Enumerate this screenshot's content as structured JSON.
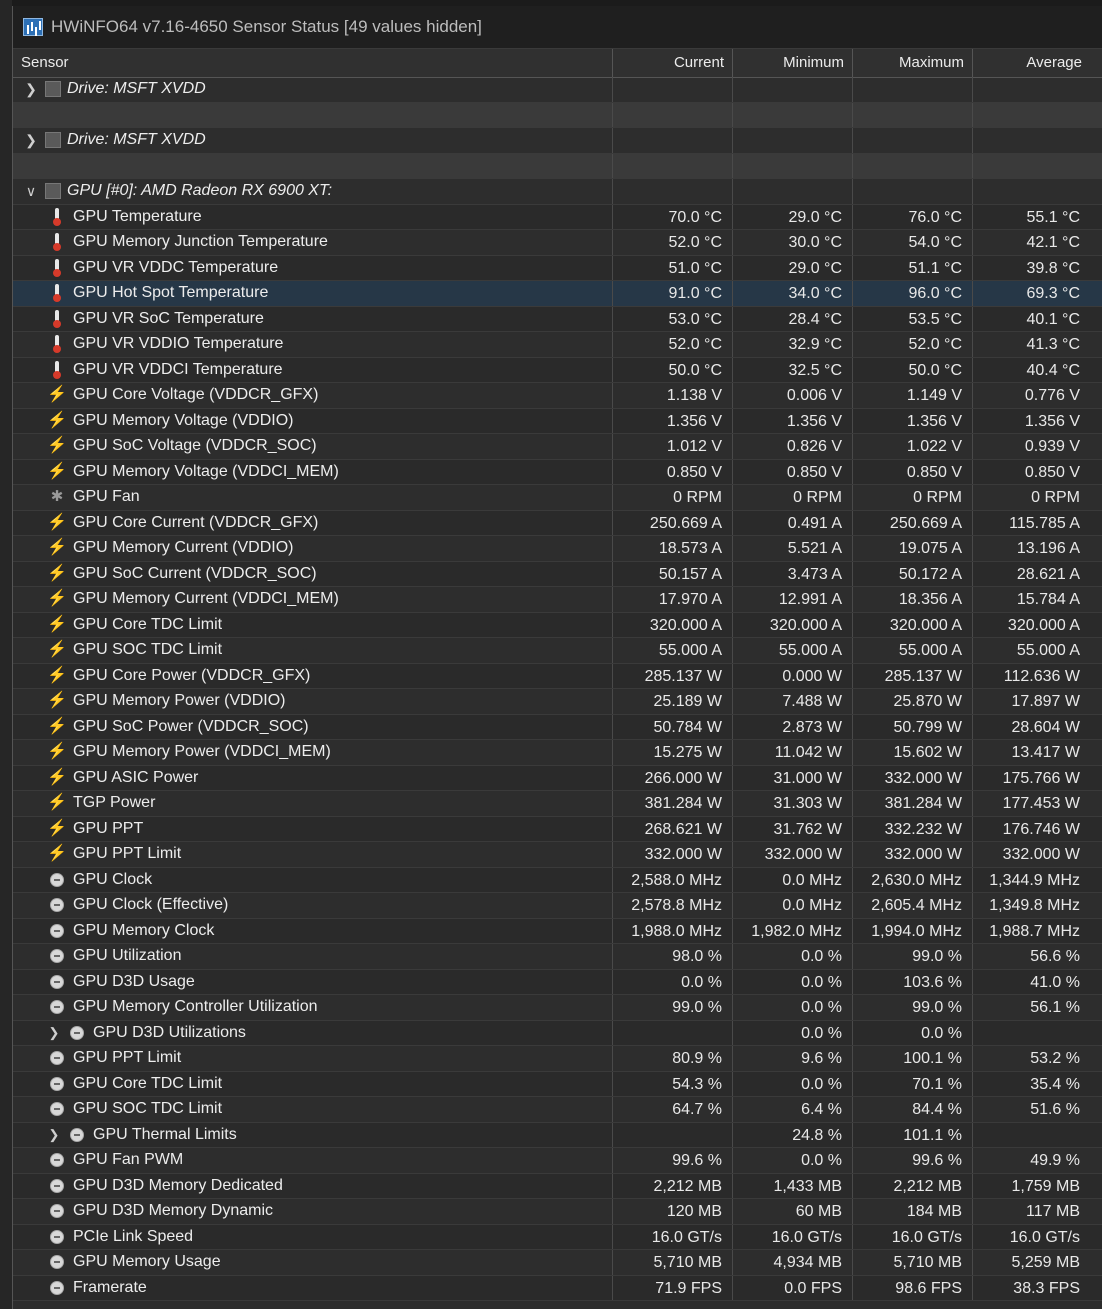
{
  "window": {
    "title": "HWiNFO64 v7.16-4650 Sensor Status [49 values hidden]"
  },
  "columns": {
    "sensor": "Sensor",
    "current": "Current",
    "minimum": "Minimum",
    "maximum": "Maximum",
    "average": "Average"
  },
  "rows": [
    {
      "kind": "device",
      "expand": "collapsed",
      "label": "Drive: MSFT XVDD",
      "icon": "drive-icon"
    },
    {
      "kind": "blank"
    },
    {
      "kind": "device",
      "expand": "collapsed",
      "label": "Drive: MSFT XVDD",
      "icon": "drive-icon"
    },
    {
      "kind": "blank"
    },
    {
      "kind": "device",
      "expand": "expanded",
      "label": "GPU [#0]: AMD Radeon RX 6900 XT:",
      "icon": "gpu-icon"
    },
    {
      "kind": "sensor",
      "icon": "thermometer-icon",
      "label": "GPU Temperature",
      "current": "70.0 °C",
      "minimum": "29.0 °C",
      "maximum": "76.0 °C",
      "average": "55.1 °C"
    },
    {
      "kind": "sensor",
      "icon": "thermometer-icon",
      "label": "GPU Memory Junction Temperature",
      "current": "52.0 °C",
      "minimum": "30.0 °C",
      "maximum": "54.0 °C",
      "average": "42.1 °C"
    },
    {
      "kind": "sensor",
      "icon": "thermometer-icon",
      "label": "GPU VR VDDC Temperature",
      "current": "51.0 °C",
      "minimum": "29.0 °C",
      "maximum": "51.1 °C",
      "average": "39.8 °C"
    },
    {
      "kind": "sensor",
      "icon": "thermometer-icon",
      "label": "GPU Hot Spot Temperature",
      "current": "91.0 °C",
      "minimum": "34.0 °C",
      "maximum": "96.0 °C",
      "average": "69.3 °C",
      "selected": true
    },
    {
      "kind": "sensor",
      "icon": "thermometer-icon",
      "label": "GPU VR SoC Temperature",
      "current": "53.0 °C",
      "minimum": "28.4 °C",
      "maximum": "53.5 °C",
      "average": "40.1 °C"
    },
    {
      "kind": "sensor",
      "icon": "thermometer-icon",
      "label": "GPU VR VDDIO Temperature",
      "current": "52.0 °C",
      "minimum": "32.9 °C",
      "maximum": "52.0 °C",
      "average": "41.3 °C"
    },
    {
      "kind": "sensor",
      "icon": "thermometer-icon",
      "label": "GPU VR VDDCI Temperature",
      "current": "50.0 °C",
      "minimum": "32.5 °C",
      "maximum": "50.0 °C",
      "average": "40.4 °C"
    },
    {
      "kind": "sensor",
      "icon": "bolt-icon",
      "label": "GPU Core Voltage (VDDCR_GFX)",
      "current": "1.138 V",
      "minimum": "0.006 V",
      "maximum": "1.149 V",
      "average": "0.776 V"
    },
    {
      "kind": "sensor",
      "icon": "bolt-icon",
      "label": "GPU Memory Voltage (VDDIO)",
      "current": "1.356 V",
      "minimum": "1.356 V",
      "maximum": "1.356 V",
      "average": "1.356 V"
    },
    {
      "kind": "sensor",
      "icon": "bolt-icon",
      "label": "GPU SoC Voltage (VDDCR_SOC)",
      "current": "1.012 V",
      "minimum": "0.826 V",
      "maximum": "1.022 V",
      "average": "0.939 V"
    },
    {
      "kind": "sensor",
      "icon": "bolt-icon",
      "label": "GPU Memory Voltage (VDDCI_MEM)",
      "current": "0.850 V",
      "minimum": "0.850 V",
      "maximum": "0.850 V",
      "average": "0.850 V"
    },
    {
      "kind": "sensor",
      "icon": "fan-icon",
      "label": "GPU Fan",
      "current": "0 RPM",
      "minimum": "0 RPM",
      "maximum": "0 RPM",
      "average": "0 RPM"
    },
    {
      "kind": "sensor",
      "icon": "bolt-icon",
      "label": "GPU Core Current (VDDCR_GFX)",
      "current": "250.669 A",
      "minimum": "0.491 A",
      "maximum": "250.669 A",
      "average": "115.785 A"
    },
    {
      "kind": "sensor",
      "icon": "bolt-icon",
      "label": "GPU Memory Current (VDDIO)",
      "current": "18.573 A",
      "minimum": "5.521 A",
      "maximum": "19.075 A",
      "average": "13.196 A"
    },
    {
      "kind": "sensor",
      "icon": "bolt-icon",
      "label": "GPU SoC Current (VDDCR_SOC)",
      "current": "50.157 A",
      "minimum": "3.473 A",
      "maximum": "50.172 A",
      "average": "28.621 A"
    },
    {
      "kind": "sensor",
      "icon": "bolt-icon",
      "label": "GPU Memory Current (VDDCI_MEM)",
      "current": "17.970 A",
      "minimum": "12.991 A",
      "maximum": "18.356 A",
      "average": "15.784 A"
    },
    {
      "kind": "sensor",
      "icon": "bolt-icon",
      "label": "GPU Core TDC Limit",
      "current": "320.000 A",
      "minimum": "320.000 A",
      "maximum": "320.000 A",
      "average": "320.000 A"
    },
    {
      "kind": "sensor",
      "icon": "bolt-icon",
      "label": "GPU SOC TDC Limit",
      "current": "55.000 A",
      "minimum": "55.000 A",
      "maximum": "55.000 A",
      "average": "55.000 A"
    },
    {
      "kind": "sensor",
      "icon": "bolt-icon",
      "label": "GPU Core Power (VDDCR_GFX)",
      "current": "285.137 W",
      "minimum": "0.000 W",
      "maximum": "285.137 W",
      "average": "112.636 W"
    },
    {
      "kind": "sensor",
      "icon": "bolt-icon",
      "label": "GPU Memory Power (VDDIO)",
      "current": "25.189 W",
      "minimum": "7.488 W",
      "maximum": "25.870 W",
      "average": "17.897 W"
    },
    {
      "kind": "sensor",
      "icon": "bolt-icon",
      "label": "GPU SoC Power (VDDCR_SOC)",
      "current": "50.784 W",
      "minimum": "2.873 W",
      "maximum": "50.799 W",
      "average": "28.604 W"
    },
    {
      "kind": "sensor",
      "icon": "bolt-icon",
      "label": "GPU Memory Power (VDDCI_MEM)",
      "current": "15.275 W",
      "minimum": "11.042 W",
      "maximum": "15.602 W",
      "average": "13.417 W"
    },
    {
      "kind": "sensor",
      "icon": "bolt-icon",
      "label": "GPU ASIC Power",
      "current": "266.000 W",
      "minimum": "31.000 W",
      "maximum": "332.000 W",
      "average": "175.766 W"
    },
    {
      "kind": "sensor",
      "icon": "bolt-icon",
      "label": "TGP Power",
      "current": "381.284 W",
      "minimum": "31.303 W",
      "maximum": "381.284 W",
      "average": "177.453 W"
    },
    {
      "kind": "sensor",
      "icon": "bolt-icon",
      "label": "GPU PPT",
      "current": "268.621 W",
      "minimum": "31.762 W",
      "maximum": "332.232 W",
      "average": "176.746 W"
    },
    {
      "kind": "sensor",
      "icon": "bolt-icon",
      "label": "GPU PPT Limit",
      "current": "332.000 W",
      "minimum": "332.000 W",
      "maximum": "332.000 W",
      "average": "332.000 W"
    },
    {
      "kind": "sensor",
      "icon": "clock-icon",
      "label": "GPU Clock",
      "current": "2,588.0 MHz",
      "minimum": "0.0 MHz",
      "maximum": "2,630.0 MHz",
      "average": "1,344.9 MHz"
    },
    {
      "kind": "sensor",
      "icon": "clock-icon",
      "label": "GPU Clock (Effective)",
      "current": "2,578.8 MHz",
      "minimum": "0.0 MHz",
      "maximum": "2,605.4 MHz",
      "average": "1,349.8 MHz"
    },
    {
      "kind": "sensor",
      "icon": "clock-icon",
      "label": "GPU Memory Clock",
      "current": "1,988.0 MHz",
      "minimum": "1,982.0 MHz",
      "maximum": "1,994.0 MHz",
      "average": "1,988.7 MHz"
    },
    {
      "kind": "sensor",
      "icon": "clock-icon",
      "label": "GPU Utilization",
      "current": "98.0 %",
      "minimum": "0.0 %",
      "maximum": "99.0 %",
      "average": "56.6 %"
    },
    {
      "kind": "sensor",
      "icon": "clock-icon",
      "label": "GPU D3D Usage",
      "current": "0.0 %",
      "minimum": "0.0 %",
      "maximum": "103.6 %",
      "average": "41.0 %"
    },
    {
      "kind": "sensor",
      "icon": "clock-icon",
      "label": "GPU Memory Controller Utilization",
      "current": "99.0 %",
      "minimum": "0.0 %",
      "maximum": "99.0 %",
      "average": "56.1 %"
    },
    {
      "kind": "group",
      "icon": "clock-icon",
      "label": "GPU D3D Utilizations",
      "current": "",
      "minimum": "0.0 %",
      "maximum": "0.0 %",
      "average": ""
    },
    {
      "kind": "sensor",
      "icon": "clock-icon",
      "label": "GPU PPT Limit",
      "current": "80.9 %",
      "minimum": "9.6 %",
      "maximum": "100.1 %",
      "average": "53.2 %"
    },
    {
      "kind": "sensor",
      "icon": "clock-icon",
      "label": "GPU Core TDC Limit",
      "current": "54.3 %",
      "minimum": "0.0 %",
      "maximum": "70.1 %",
      "average": "35.4 %"
    },
    {
      "kind": "sensor",
      "icon": "clock-icon",
      "label": "GPU SOC TDC Limit",
      "current": "64.7 %",
      "minimum": "6.4 %",
      "maximum": "84.4 %",
      "average": "51.6 %"
    },
    {
      "kind": "group",
      "icon": "clock-icon",
      "label": "GPU Thermal Limits",
      "current": "",
      "minimum": "24.8 %",
      "maximum": "101.1 %",
      "average": ""
    },
    {
      "kind": "sensor",
      "icon": "clock-icon",
      "label": "GPU Fan PWM",
      "current": "99.6 %",
      "minimum": "0.0 %",
      "maximum": "99.6 %",
      "average": "49.9 %"
    },
    {
      "kind": "sensor",
      "icon": "clock-icon",
      "label": "GPU D3D Memory Dedicated",
      "current": "2,212 MB",
      "minimum": "1,433 MB",
      "maximum": "2,212 MB",
      "average": "1,759 MB"
    },
    {
      "kind": "sensor",
      "icon": "clock-icon",
      "label": "GPU D3D Memory Dynamic",
      "current": "120 MB",
      "minimum": "60 MB",
      "maximum": "184 MB",
      "average": "117 MB"
    },
    {
      "kind": "sensor",
      "icon": "clock-icon",
      "label": "PCIe Link Speed",
      "current": "16.0 GT/s",
      "minimum": "16.0 GT/s",
      "maximum": "16.0 GT/s",
      "average": "16.0 GT/s"
    },
    {
      "kind": "sensor",
      "icon": "clock-icon",
      "label": "GPU Memory Usage",
      "current": "5,710 MB",
      "minimum": "4,934 MB",
      "maximum": "5,710 MB",
      "average": "5,259 MB"
    },
    {
      "kind": "sensor",
      "icon": "clock-icon",
      "label": "Framerate",
      "current": "71.9 FPS",
      "minimum": "0.0 FPS",
      "maximum": "98.6 FPS",
      "average": "38.3 FPS"
    }
  ]
}
